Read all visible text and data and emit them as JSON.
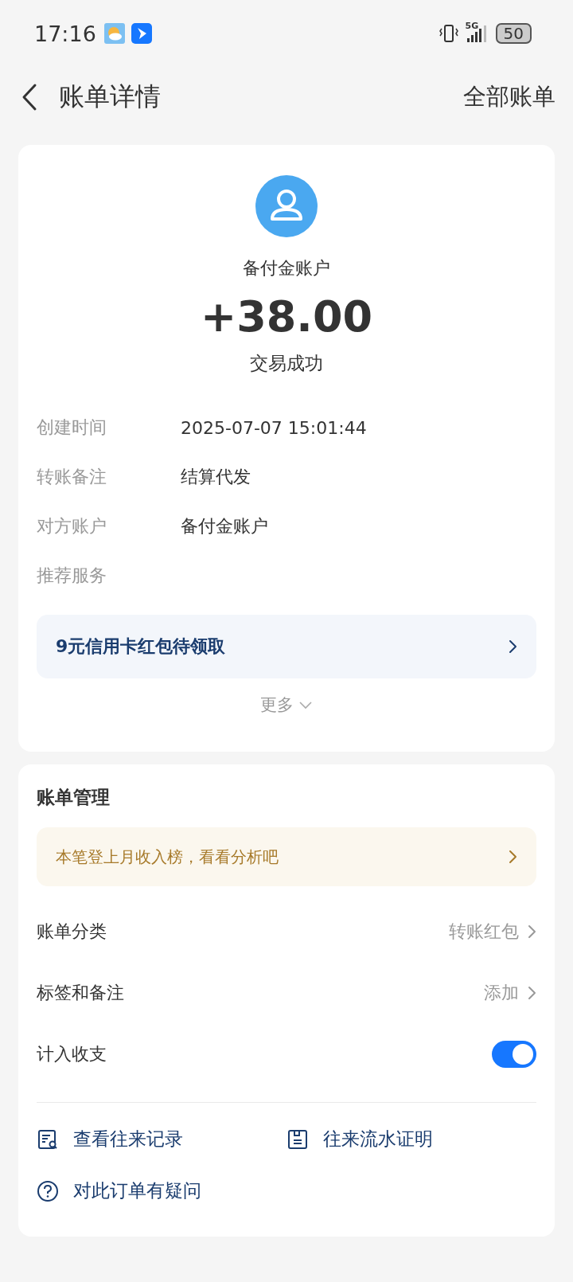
{
  "status_bar": {
    "time": "17:16",
    "network": "5G",
    "battery": "50"
  },
  "header": {
    "title": "账单详情",
    "action": "全部账单"
  },
  "summary": {
    "account": "备付金账户",
    "amount": "+38.00",
    "status": "交易成功"
  },
  "details": [
    {
      "label": "创建时间",
      "value": "2025-07-07 15:01:44"
    },
    {
      "label": "转账备注",
      "value": "结算代发"
    },
    {
      "label": "对方账户",
      "value": "备付金账户"
    },
    {
      "label": "推荐服务"
    }
  ],
  "promo": {
    "text": "9元信用卡红包待领取"
  },
  "more": "更多",
  "management": {
    "title": "账单管理",
    "banner": "本笔登上月收入榜，看看分析吧",
    "rows": [
      {
        "kind": "link",
        "label": "账单分类",
        "value": "转账红包"
      },
      {
        "kind": "link",
        "label": "标签和备注",
        "value": "添加"
      },
      {
        "kind": "toggle",
        "label": "计入收支",
        "on": true
      }
    ],
    "links": [
      {
        "kind": "records",
        "label": "查看往来记录"
      },
      {
        "kind": "proof",
        "label": "往来流水证明"
      },
      {
        "kind": "question",
        "label": "对此订单有疑问"
      }
    ]
  }
}
